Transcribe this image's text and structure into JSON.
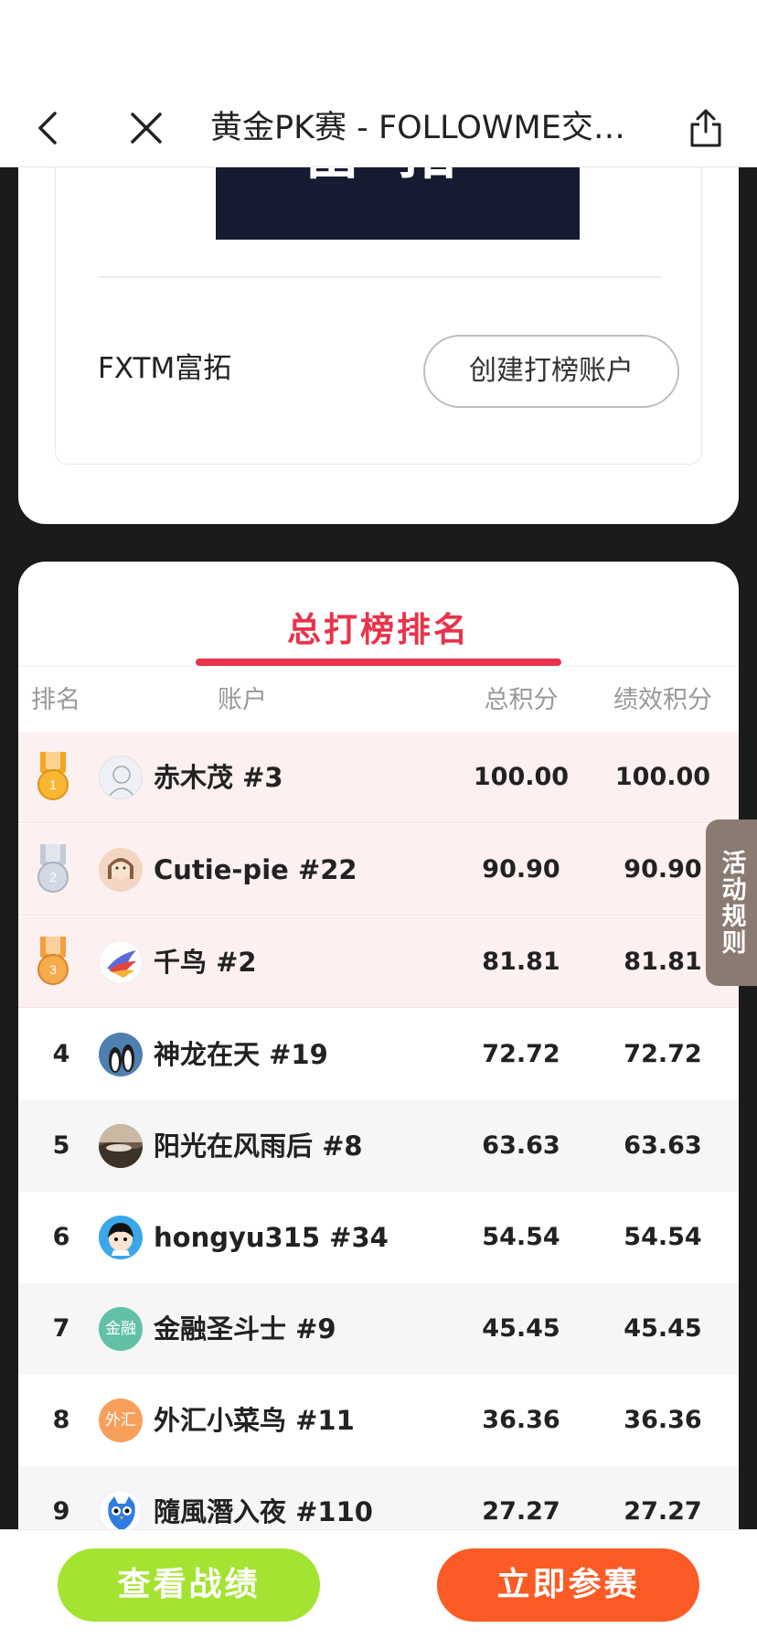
{
  "nav": {
    "title": "黄金PK赛 - FOLLOWME交…"
  },
  "broker": {
    "logo_text": "富拓",
    "name": "FXTM富拓",
    "create_button": "创建打榜账户"
  },
  "ranking": {
    "tab_title": "总打榜排名",
    "columns": {
      "rank": "排名",
      "account": "账户",
      "total": "总积分",
      "performance": "绩效积分"
    },
    "rows": [
      {
        "rank": "1",
        "name": "赤木茂 #3",
        "total": "100.00",
        "performance": "100.00",
        "avatar": "sketch-avatar"
      },
      {
        "rank": "2",
        "name": "Cutie-pie #22",
        "total": "90.90",
        "performance": "90.90",
        "avatar": "girl-avatar"
      },
      {
        "rank": "3",
        "name": "千鸟 #2",
        "total": "81.81",
        "performance": "81.81",
        "avatar": "bird-avatar"
      },
      {
        "rank": "4",
        "name": "神龙在天 #19",
        "total": "72.72",
        "performance": "72.72",
        "avatar": "penguin-avatar"
      },
      {
        "rank": "5",
        "name": "阳光在风雨后 #8",
        "total": "63.63",
        "performance": "63.63",
        "avatar": "photo-avatar"
      },
      {
        "rank": "6",
        "name": "hongyu315 #34",
        "total": "54.54",
        "performance": "54.54",
        "avatar": "cartoon-avatar"
      },
      {
        "rank": "7",
        "name": "金融圣斗士 #9",
        "total": "45.45",
        "performance": "45.45",
        "avatar_text": "金融",
        "avatar_color": "#62c0a7"
      },
      {
        "rank": "8",
        "name": "外汇小菜鸟 #11",
        "total": "36.36",
        "performance": "36.36",
        "avatar_text": "外汇",
        "avatar_color": "#f7a05b"
      },
      {
        "rank": "9",
        "name": "隨風潛入夜 #110",
        "total": "27.27",
        "performance": "27.27",
        "avatar": "owl-avatar"
      }
    ]
  },
  "rules_tab": "活动规则",
  "bottom": {
    "view_button": "查看战绩",
    "join_button": "立即参赛"
  },
  "colors": {
    "accent": "#e8334a",
    "top3_bg": "#fdf0f0",
    "view_button": "#a5e332",
    "join_button": "#fc5b25",
    "gold": "#f5a623",
    "silver": "#c4cbd8",
    "bronze": "#f4a03c"
  }
}
